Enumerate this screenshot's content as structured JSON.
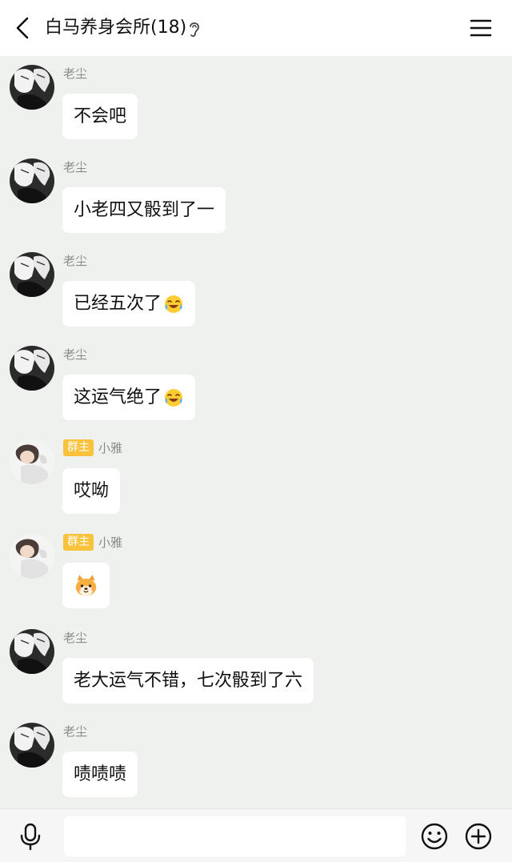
{
  "header": {
    "title": "白马养身会所(18)",
    "back_icon": "chevron-left-icon",
    "ear_icon": "ear-icon",
    "menu_icon": "hamburger-menu-icon"
  },
  "messages": [
    {
      "sender": "老尘",
      "badge": "",
      "text": "不会吧",
      "emoji": ""
    },
    {
      "sender": "老尘",
      "badge": "",
      "text": "小老四又骰到了一",
      "emoji": ""
    },
    {
      "sender": "老尘",
      "badge": "",
      "text": "已经五次了",
      "emoji": "laughing-tears-emoji"
    },
    {
      "sender": "老尘",
      "badge": "",
      "text": "这运气绝了",
      "emoji": "laughing-tears-emoji"
    },
    {
      "sender": "小雅",
      "badge": "群主",
      "text": "哎呦",
      "emoji": ""
    },
    {
      "sender": "小雅",
      "badge": "群主",
      "text": "",
      "emoji": "shiba-dog-emoji"
    },
    {
      "sender": "老尘",
      "badge": "",
      "text": "老大运气不错，七次骰到了六",
      "emoji": ""
    },
    {
      "sender": "老尘",
      "badge": "",
      "text": "啧啧啧",
      "emoji": ""
    }
  ],
  "input": {
    "value": "",
    "placeholder": ""
  },
  "bottombar": {
    "mic_icon": "microphone-icon",
    "emoji_icon": "smiley-face-icon",
    "plus_icon": "plus-circle-icon"
  },
  "colors": {
    "background": "#eef1ed",
    "bubble": "#ffffff",
    "badge": "#f8c23d",
    "sender_text": "#8b8b8b"
  }
}
